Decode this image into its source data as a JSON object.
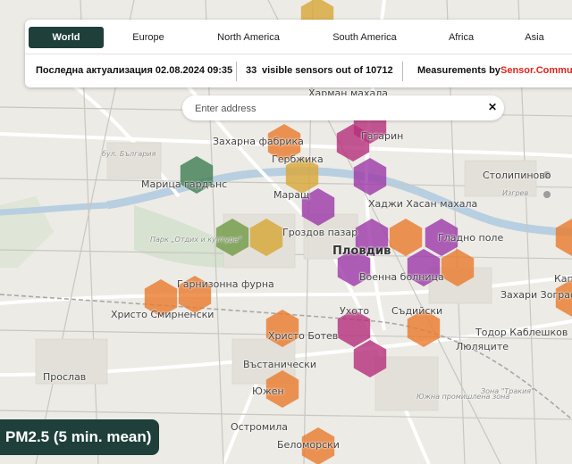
{
  "tabs": [
    {
      "label": "World",
      "active": true
    },
    {
      "label": "Europe",
      "active": false
    },
    {
      "label": "North America",
      "active": false
    },
    {
      "label": "South America",
      "active": false
    },
    {
      "label": "Africa",
      "active": false
    },
    {
      "label": "Asia",
      "active": false
    }
  ],
  "status": {
    "last_update": "Последна актуализация 02.08.2024 09:35",
    "visible_count": "33",
    "visible_text": "visible sensors out of",
    "total": "10712",
    "measurements_prefix": "Measurements by",
    "measurements_source": "Sensor.Community"
  },
  "search": {
    "placeholder": "Enter address",
    "clear_icon": "close-icon"
  },
  "badge": {
    "metric": "PM2.5 (5 min. mean)"
  },
  "map_labels": [
    "Харман махала",
    "Гагарин",
    "Захарна фабрика",
    "Гербжика",
    "Марица гардънс",
    "Столипиново",
    "Маращ",
    "Хаджи Хасан махала",
    "Гроздов пазар",
    "Гладно поле",
    "Пловдив",
    "Военна болница",
    "Гарнизонна фурна",
    "Христо Смирненски",
    "Христо Ботев",
    "Съдийски",
    "Тодор Каблешков",
    "Люляците",
    "Захари Зограф",
    "Въстанически",
    "Прослав",
    "Южен",
    "Остромила",
    "Беломорски",
    "Изгрев",
    "Каплан",
    "бул. България",
    "Парк „Отдих и култура“",
    "Южна промишлена зона",
    "Зона \"Тракия\"",
    "Ухото"
  ],
  "colors": {
    "purple": "#9c38a8",
    "magenta": "#b52e7a",
    "orange": "#ea7b2d",
    "yellow": "#d8a636",
    "green": "#3e7d52",
    "olive": "#6f9a45",
    "panel": "#1e3f3a",
    "accent": "#e3231b"
  }
}
